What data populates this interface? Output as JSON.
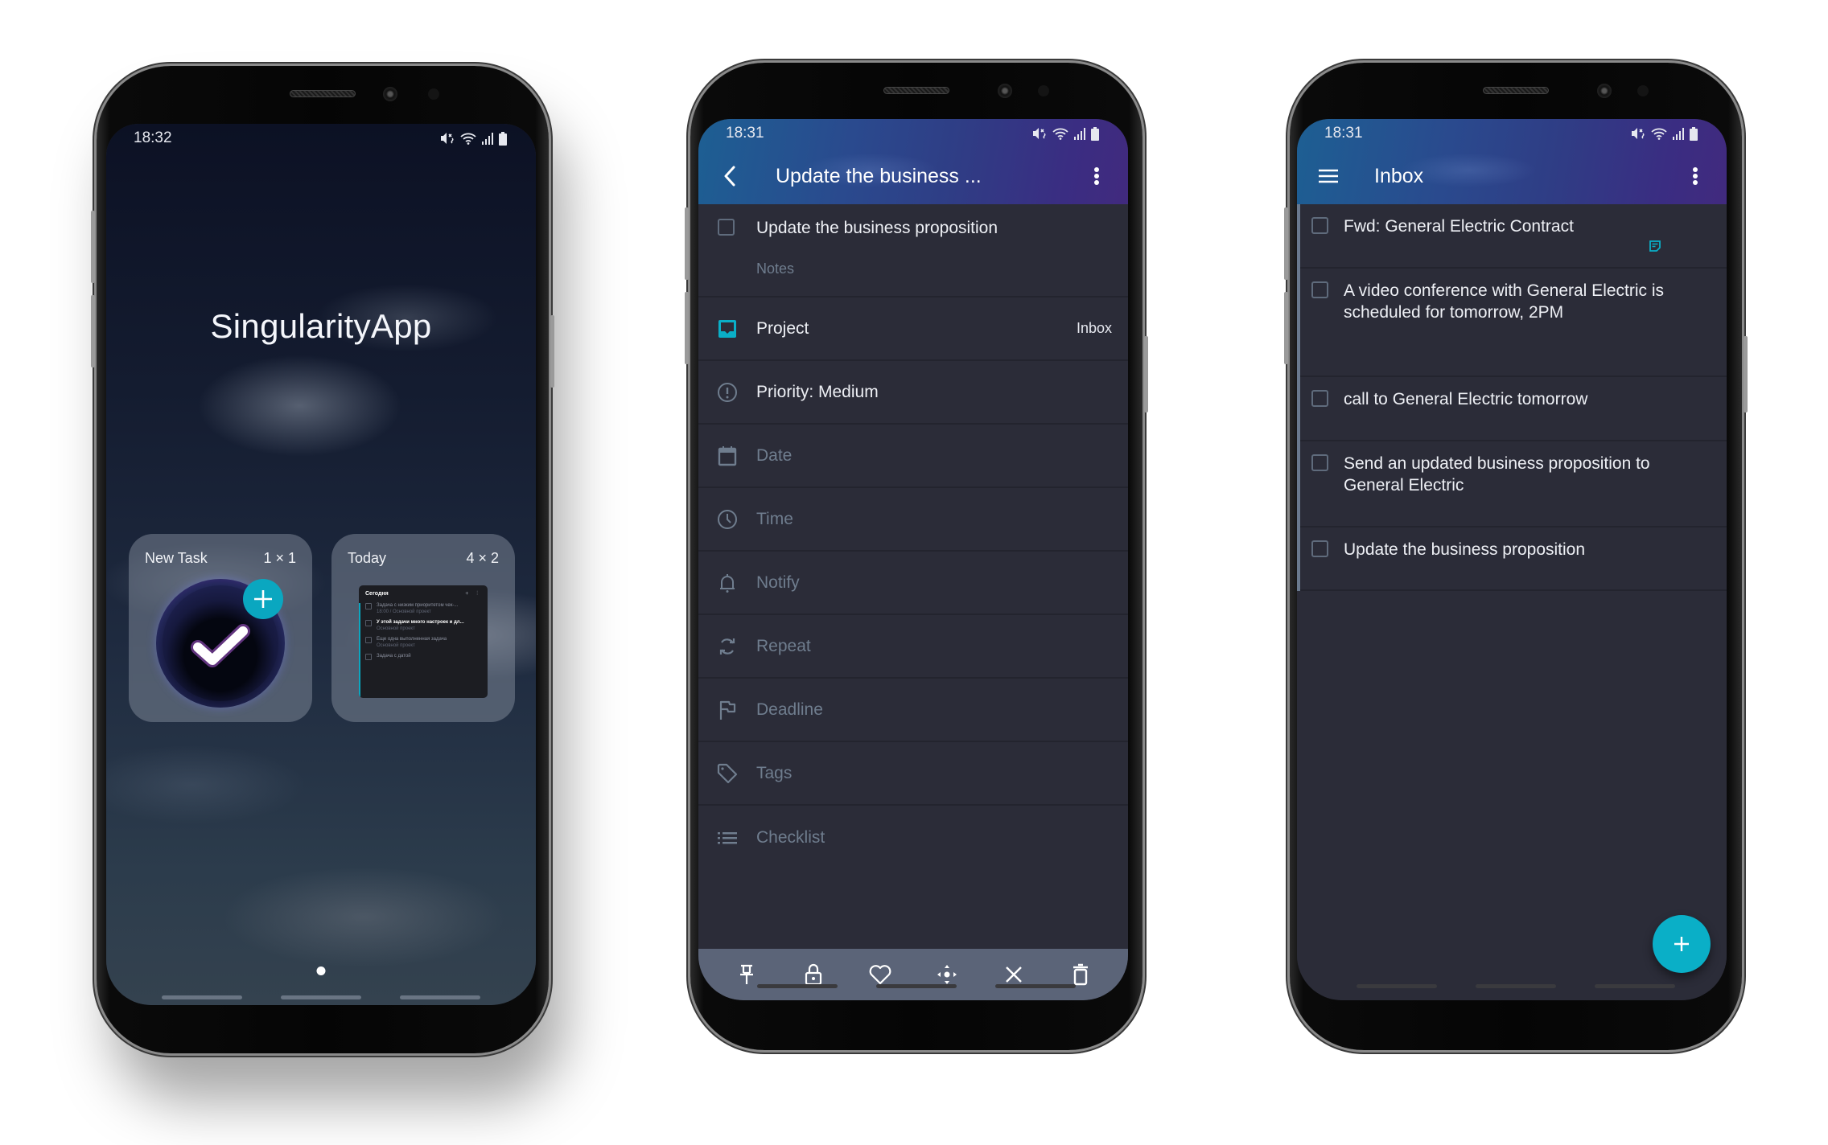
{
  "phones": [
    {
      "id": "home",
      "status_bar": {
        "time": "18:32",
        "icons": [
          "mute-vibrate-icon",
          "wifi-icon",
          "signal-icon",
          "battery-icon"
        ]
      },
      "app_name": "SingularityApp",
      "widgets": [
        {
          "name": "New Task",
          "size": "1 × 1",
          "icon": "singularity-check-logo",
          "badge_icon": "plus-icon"
        },
        {
          "name": "Today",
          "size": "4 × 2",
          "preview": {
            "title": "Сегодня",
            "items": [
              {
                "text": "Задача с низким приоритетом чек-...",
                "sub": "18:00 / Основной проект",
                "bold": false
              },
              {
                "text": "У этой задачи много настроек и дл...",
                "sub": "Основной проект",
                "bold": true
              },
              {
                "text": "Еще одна выполненная задача",
                "sub": "Основной проект",
                "bold": false
              },
              {
                "text": "Задача с датой",
                "sub": "",
                "bold": false
              }
            ]
          }
        }
      ],
      "page_indicator": {
        "pages": 1,
        "current": 1
      }
    },
    {
      "id": "task-detail",
      "status_bar": {
        "time": "18:31",
        "icons": [
          "mute-vibrate-icon",
          "wifi-icon",
          "signal-icon",
          "battery-icon"
        ]
      },
      "toolbar": {
        "title": "Update the business ...",
        "back_icon": "chevron-left-icon",
        "menu_icon": "more-vertical-icon"
      },
      "task": {
        "title": "Update the business proposition",
        "notes_placeholder": "Notes",
        "completed": false
      },
      "properties": [
        {
          "icon": "inbox-icon",
          "label": "Project",
          "value": "Inbox",
          "active": true
        },
        {
          "icon": "priority-icon",
          "label": "Priority: Medium",
          "value": "",
          "active": true
        },
        {
          "icon": "calendar-icon",
          "label": "Date",
          "value": "",
          "active": false
        },
        {
          "icon": "clock-icon",
          "label": "Time",
          "value": "",
          "active": false
        },
        {
          "icon": "bell-icon",
          "label": "Notify",
          "value": "",
          "active": false
        },
        {
          "icon": "repeat-icon",
          "label": "Repeat",
          "value": "",
          "active": false
        },
        {
          "icon": "flag-icon",
          "label": "Deadline",
          "value": "",
          "active": false
        },
        {
          "icon": "tag-icon",
          "label": "Tags",
          "value": "",
          "active": false
        },
        {
          "icon": "checklist-icon",
          "label": "Checklist",
          "value": "",
          "active": false
        }
      ],
      "bottom_toolbar": [
        "pin-icon",
        "lock-icon",
        "heart-icon",
        "move-icon",
        "close-icon",
        "trash-icon"
      ]
    },
    {
      "id": "inbox",
      "status_bar": {
        "time": "18:31",
        "icons": [
          "mute-vibrate-icon",
          "wifi-icon",
          "signal-icon",
          "battery-icon"
        ]
      },
      "toolbar": {
        "title": "Inbox",
        "menu_icon": "hamburger-menu-icon",
        "more_icon": "more-vertical-icon"
      },
      "tasks": [
        {
          "title": "Fwd: General Electric Contract",
          "has_note": true,
          "completed": false
        },
        {
          "title": "A video conference with General Electric is scheduled for tomorrow, 2PM",
          "has_note": false,
          "completed": false
        },
        {
          "title": "call to General Electric tomorrow",
          "has_note": false,
          "completed": false
        },
        {
          "title": "Send an updated business proposition to General Electric",
          "has_note": false,
          "completed": false
        },
        {
          "title": "Update the business proposition",
          "has_note": false,
          "completed": false
        }
      ],
      "fab_icon": "plus-icon"
    }
  ],
  "colors": {
    "accent": "#0aafc7",
    "background": "#2b2c38",
    "muted_text": "#6f7d8e",
    "bottom_toolbar": "#5b6478",
    "header_gradient_start": "#1d5f93",
    "header_gradient_end": "#412a7e"
  }
}
